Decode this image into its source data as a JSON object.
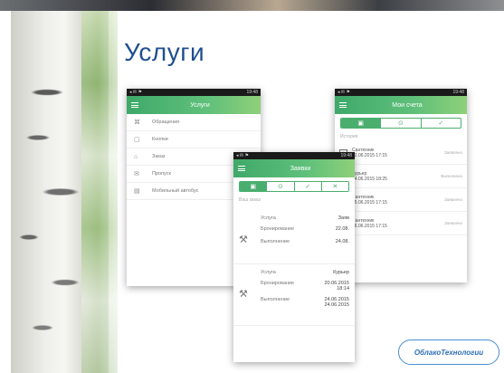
{
  "slide": {
    "title": "Услуги"
  },
  "phone_menu": {
    "status_time": "19:48",
    "app_title": "Услуги",
    "items": [
      {
        "icon": "⌘",
        "label": "Обращения"
      },
      {
        "icon": "▢",
        "label": "Кнопки"
      },
      {
        "icon": "⌂",
        "label": "Заказ"
      },
      {
        "icon": "✉",
        "label": "Пропуск"
      },
      {
        "icon": "▤",
        "label": "Мобильный автобус"
      }
    ]
  },
  "phone_orders": {
    "status_time": "19:48",
    "app_title": "Заявки",
    "tabs": [
      "▣",
      "⊙",
      "✓",
      "✕"
    ],
    "caption": "Ваш заказ",
    "orders": [
      {
        "service_label": "Услуга",
        "service_value": "Заяв",
        "reg_label": "Бронирование",
        "reg_value": "22.08.",
        "done_label": "Выполнение",
        "done_value": "24.08."
      },
      {
        "service_label": "Услуга",
        "service_value": "Курьер",
        "reg_label": "Бронирование",
        "reg_value": "20.06.2015 18:14",
        "done_label": "Выполнение",
        "done_value": "24.06.2015 24.06.2015"
      }
    ]
  },
  "phone_schedule": {
    "status_time": "19:48",
    "app_title": "Мои счета",
    "tabs": [
      "▣",
      "⊙",
      "✓"
    ],
    "caption": "История",
    "items": [
      {
        "title": "Сантехник",
        "date": "22.06.2015 17:15",
        "meta": "Заявлено"
      },
      {
        "title": "Курьер",
        "date": "24.06.2015 18:25",
        "meta": "Выполнено"
      },
      {
        "title": "Сантехник",
        "date": "25.06.2015 17:15",
        "meta": "Заявлено"
      },
      {
        "title": "Сантехник",
        "date": "26.06.2015 17:15",
        "meta": "Заявлено"
      }
    ]
  },
  "logo": {
    "text": "ОблакоТехнологии"
  },
  "colors": {
    "title": "#1f4f8f",
    "accent_green": "#4aae6e",
    "logo_blue": "#2d6fb5"
  }
}
